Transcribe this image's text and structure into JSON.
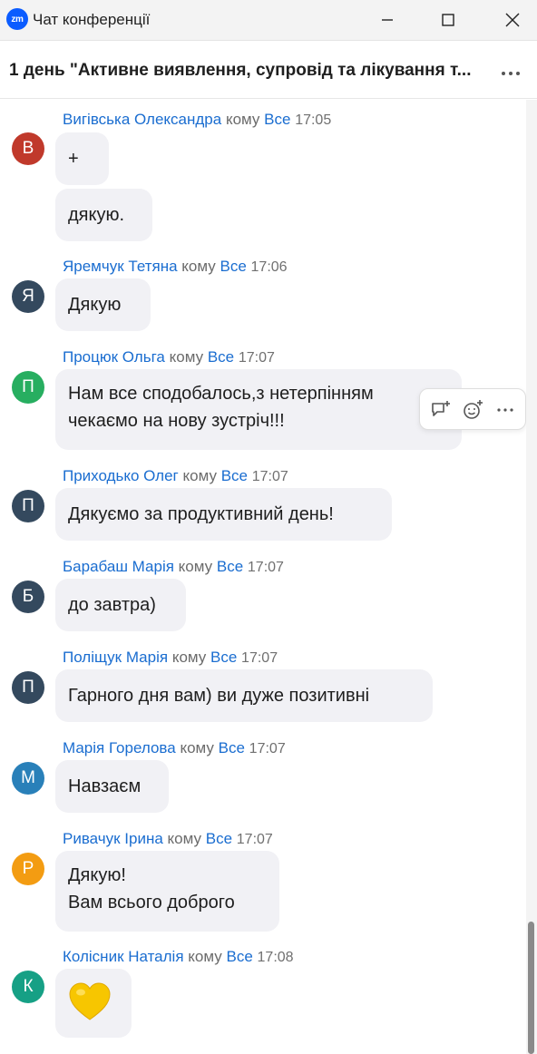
{
  "window": {
    "logo": "zm",
    "title": "Чат конференції"
  },
  "chat": {
    "title": "1 день \"Активне виявлення, супровід та лікування т..."
  },
  "messages": [
    {
      "sender": "Вигівська Олександра",
      "to": "кому",
      "recipient": "Все",
      "time": "17:05",
      "avatar": "В",
      "avatar_color": "#c0392b",
      "bubbles": [
        "+",
        "дякую."
      ]
    },
    {
      "sender": "Яремчук Тетяна",
      "to": "кому",
      "recipient": "Все",
      "time": "17:06",
      "avatar": "Я",
      "avatar_color": "#34495e",
      "bubbles": [
        "Дякую"
      ]
    },
    {
      "sender": "Процюк Ольга",
      "to": "кому",
      "recipient": "Все",
      "time": "17:07",
      "avatar": "П",
      "avatar_color": "#27ae60",
      "bubbles": [
        "Нам все сподобалось,з нетерпінням\nчекаємо на нову зустріч!!!"
      ]
    },
    {
      "sender": "Приходько Олег",
      "to": "кому",
      "recipient": "Все",
      "time": "17:07",
      "avatar": "П",
      "avatar_color": "#34495e",
      "bubbles": [
        "Дякуємо за продуктивний день!"
      ]
    },
    {
      "sender": "Барабаш Марія",
      "to": "кому",
      "recipient": "Все",
      "time": "17:07",
      "avatar": "Б",
      "avatar_color": "#34495e",
      "bubbles": [
        "до завтра)"
      ]
    },
    {
      "sender": "Поліщук Марія",
      "to": "кому",
      "recipient": "Все",
      "time": "17:07",
      "avatar": "П",
      "avatar_color": "#34495e",
      "bubbles": [
        "Гарного дня вам) ви дуже позитивні"
      ]
    },
    {
      "sender": "Марія Горелова",
      "to": "кому",
      "recipient": "Все",
      "time": "17:07",
      "avatar": "М",
      "avatar_color": "#2980b9",
      "bubbles": [
        "Навзаєм"
      ]
    },
    {
      "sender": "Ривачук Ірина",
      "to": "кому",
      "recipient": "Все",
      "time": "17:07",
      "avatar": "Р",
      "avatar_color": "#f39c12",
      "bubbles": [
        "Дякую!\nВам всього доброго"
      ]
    },
    {
      "sender": "Колісник Наталія",
      "to": "кому",
      "recipient": "Все",
      "time": "17:08",
      "avatar": "К",
      "avatar_color": "#16a085",
      "bubbles": [
        "yellow-heart-emoji"
      ]
    }
  ],
  "message_actions": [
    "reply-in-thread-icon",
    "add-reaction-icon",
    "more-icon"
  ]
}
